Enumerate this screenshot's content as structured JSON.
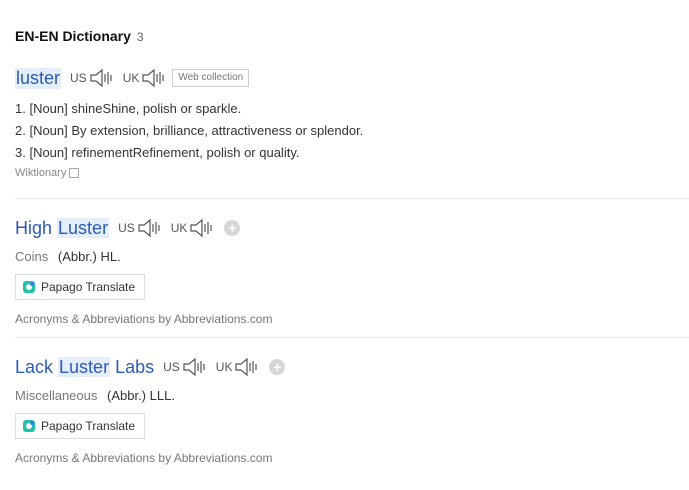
{
  "header": {
    "title": "EN-EN Dictionary",
    "count": "3"
  },
  "entries": [
    {
      "word": "luster",
      "us": "US",
      "uk": "UK",
      "badge": "Web collection",
      "defs": [
        "1. [Noun] shineShine, polish or sparkle.",
        "2. [Noun] By extension, brilliance, attractiveness or splendor.",
        "3. [Noun] refinementRefinement, polish or quality."
      ],
      "source": "Wiktionary"
    },
    {
      "word_pre": "High ",
      "word_hl": "Luster",
      "word_post": "",
      "us": "US",
      "uk": "UK",
      "category": "Coins",
      "abbr": "(Abbr.) HL.",
      "papago": "Papago Translate",
      "credit": "Acronyms & Abbreviations by Abbreviations.com"
    },
    {
      "word_pre": "Lack ",
      "word_hl": "Luster",
      "word_post": " Labs",
      "us": "US",
      "uk": "UK",
      "category": "Miscellaneous",
      "abbr": "(Abbr.) LLL.",
      "papago": "Papago Translate",
      "credit": "Acronyms & Abbreviations by Abbreviations.com"
    }
  ]
}
